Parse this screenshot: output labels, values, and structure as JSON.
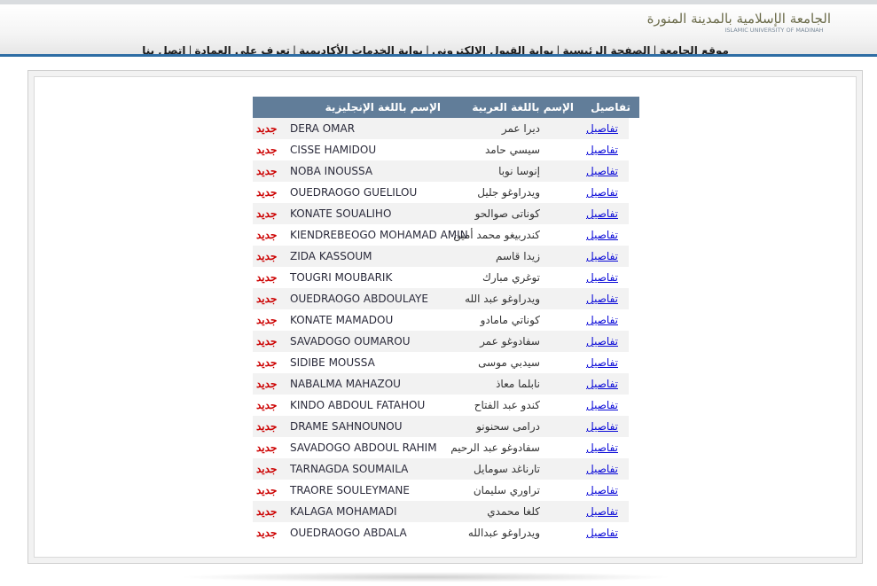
{
  "header": {
    "logo_arabic": "الجامعة الإسلامية بالمدينة المنورة",
    "logo_english": "ISLAMIC UNIVERSITY OF MADINAH",
    "nav": [
      "موقع الجامعة",
      "الصفحة الرئيسية",
      "بوابة القبول الإلكتروني",
      "بوابة الخدمات الأكاديمية",
      "تعرف على العمادة",
      "إتصل بنا"
    ]
  },
  "table": {
    "headers": {
      "details": "تفاصيل",
      "arabic_name": "الإسم باللغة العربية",
      "english_name": "الإسم باللغة الإنجليزية"
    },
    "rows": [
      {
        "details": "تفاصيل",
        "arabic": "ديرا عمر",
        "english": "DERA OMAR",
        "badge": "جديد"
      },
      {
        "details": "تفاصيل",
        "arabic": "سيسي حامد",
        "english": "CISSE HAMIDOU",
        "badge": "جديد"
      },
      {
        "details": "تفاصيل",
        "arabic": "إنوسا نوبا",
        "english": "NOBA INOUSSA",
        "badge": "جديد"
      },
      {
        "details": "تفاصيل",
        "arabic": "ويدراوغو جليل",
        "english": "OUEDRAOGO GUELILOU",
        "badge": "جديد"
      },
      {
        "details": "تفاصيل",
        "arabic": "كوناتى صوالحو",
        "english": "KONATE SOUALIHO",
        "badge": "جديد"
      },
      {
        "details": "تفاصيل",
        "arabic": "كندربيغو محمد أمين",
        "english": "KIENDREBEOGO MOHAMAD AMIN",
        "badge": "جديد"
      },
      {
        "details": "تفاصيل",
        "arabic": "زيدا قاسم",
        "english": "ZIDA KASSOUM",
        "badge": "جديد"
      },
      {
        "details": "تفاصيل",
        "arabic": "توغري مبارك",
        "english": "TOUGRI MOUBARIK",
        "badge": "جديد"
      },
      {
        "details": "تفاصيل",
        "arabic": "ويدراوغو عبد الله",
        "english": "OUEDRAOGO ABDOULAYE",
        "badge": "جديد"
      },
      {
        "details": "تفاصيل",
        "arabic": "كوناتي مامادو",
        "english": "KONATE MAMADOU",
        "badge": "جديد"
      },
      {
        "details": "تفاصيل",
        "arabic": "سفادوغو عمر",
        "english": "SAVADOGO OUMAROU",
        "badge": "جديد"
      },
      {
        "details": "تفاصيل",
        "arabic": "سيدبي موسى",
        "english": "SIDIBE MOUSSA",
        "badge": "جديد"
      },
      {
        "details": "تفاصيل",
        "arabic": "نابلما معاذ",
        "english": "NABALMA MAHAZOU",
        "badge": "جديد"
      },
      {
        "details": "تفاصيل",
        "arabic": "كندو عبد الفتاح",
        "english": "KINDO ABDOUL FATAHOU",
        "badge": "جديد"
      },
      {
        "details": "تفاصيل",
        "arabic": "درامى سحنونو",
        "english": "DRAME SAHNOUNOU",
        "badge": "جديد"
      },
      {
        "details": "تفاصيل",
        "arabic": "سفادوغو عبد الرحيم",
        "english": "SAVADOGO ABDOUL RAHIM",
        "badge": "جديد"
      },
      {
        "details": "تفاصيل",
        "arabic": "تارناغد سومايل",
        "english": "TARNAGDA SOUMAILA",
        "badge": "جديد"
      },
      {
        "details": "تفاصيل",
        "arabic": "تراوري سليمان",
        "english": "TRAORE SOULEYMANE",
        "badge": "جديد"
      },
      {
        "details": "تفاصيل",
        "arabic": "كلغا محمدي",
        "english": "KALAGA MOHAMADI",
        "badge": "جديد"
      },
      {
        "details": "تفاصيل",
        "arabic": "ويدراوغو عبدالله",
        "english": "OUEDRAOGO ABDALA",
        "badge": "جديد"
      }
    ]
  }
}
